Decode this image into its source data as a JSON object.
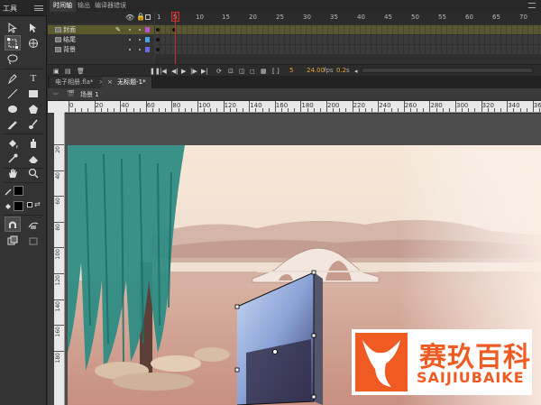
{
  "tools_panel": {
    "title": "工具"
  },
  "timeline": {
    "tabs": [
      "时间轴",
      "输出",
      "编译器错误"
    ],
    "frame_numbers": [
      "1",
      "5",
      "10",
      "15",
      "20",
      "25",
      "30",
      "35",
      "40",
      "45",
      "50",
      "55",
      "60",
      "65",
      "70"
    ],
    "layers": [
      {
        "name": "封面",
        "active": true,
        "color": "#c050d0"
      },
      {
        "name": "结尾",
        "active": false,
        "color": "#4fa0e0"
      },
      {
        "name": "背景",
        "active": false,
        "color": "#6a6ae0"
      }
    ],
    "current_frame": "5",
    "fps": "24.00",
    "fps_unit": "fps",
    "time": "0.2",
    "time_unit": "s"
  },
  "documents": {
    "tabs": [
      "电子相册.fla*",
      "无标题-1*"
    ],
    "active_index": 1
  },
  "breadcrumb": {
    "scene": "场景 1"
  },
  "rulers": {
    "horizontal": [
      "0",
      "20",
      "40",
      "60",
      "80",
      "100",
      "120",
      "140",
      "160",
      "180",
      "200",
      "220",
      "240",
      "260",
      "280",
      "300",
      "320",
      "340",
      "360"
    ],
    "vertical": [
      "20",
      "40",
      "60",
      "80",
      "100",
      "120",
      "140",
      "160",
      "180"
    ]
  },
  "watermark": {
    "chinese": "赛玖百科",
    "pinyin": "SAIJIUBAIKE",
    "color": "#f05b24"
  }
}
